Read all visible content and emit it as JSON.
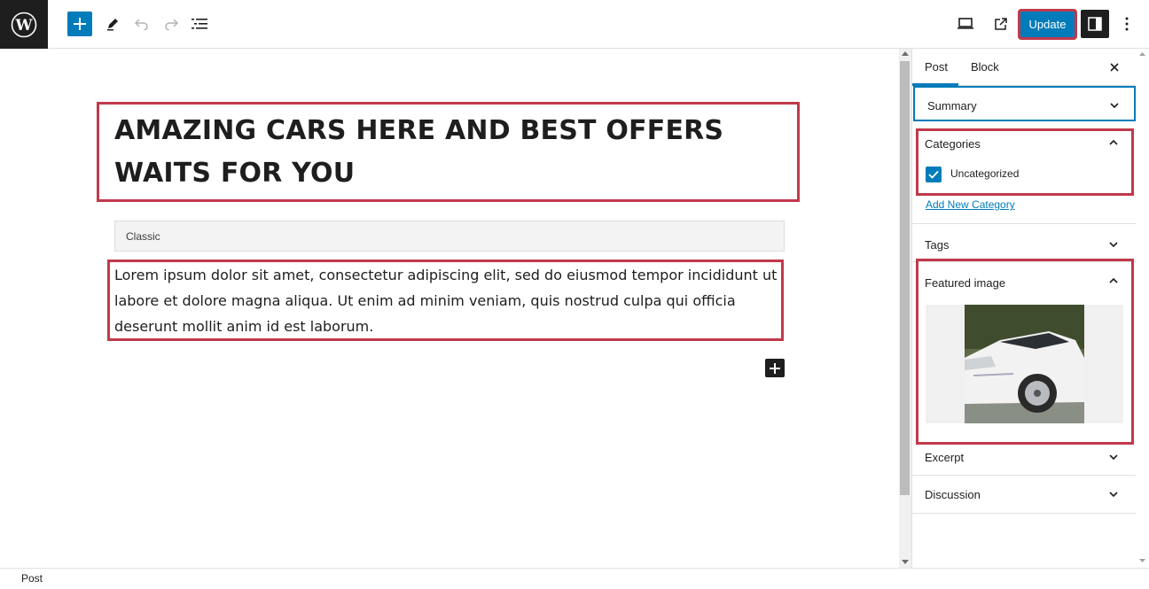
{
  "toolbar": {
    "update_label": "Update"
  },
  "post": {
    "title": "AMAZING CARS HERE AND BEST OFFERS WAITS FOR YOU",
    "classic_label": "Classic",
    "paragraph": "Lorem ipsum dolor sit amet, consectetur adipiscing elit, sed do eiusmod tempor incididunt ut labore et dolore magna aliqua. Ut enim ad minim veniam, quis nostrud culpa qui officia deserunt mollit anim id est laborum."
  },
  "sidebar": {
    "tabs": [
      {
        "label": "Post",
        "active": true
      },
      {
        "label": "Block",
        "active": false
      }
    ],
    "panels": {
      "summary": "Summary",
      "categories": "Categories",
      "category_item": "Uncategorized",
      "add_category": "Add New Category",
      "tags": "Tags",
      "featured_image": "Featured image",
      "excerpt": "Excerpt",
      "discussion": "Discussion"
    }
  },
  "footer": {
    "breadcrumb": "Post"
  },
  "colors": {
    "accent": "#007cba",
    "highlight": "#c0394b",
    "dark": "#1e1e1e"
  }
}
